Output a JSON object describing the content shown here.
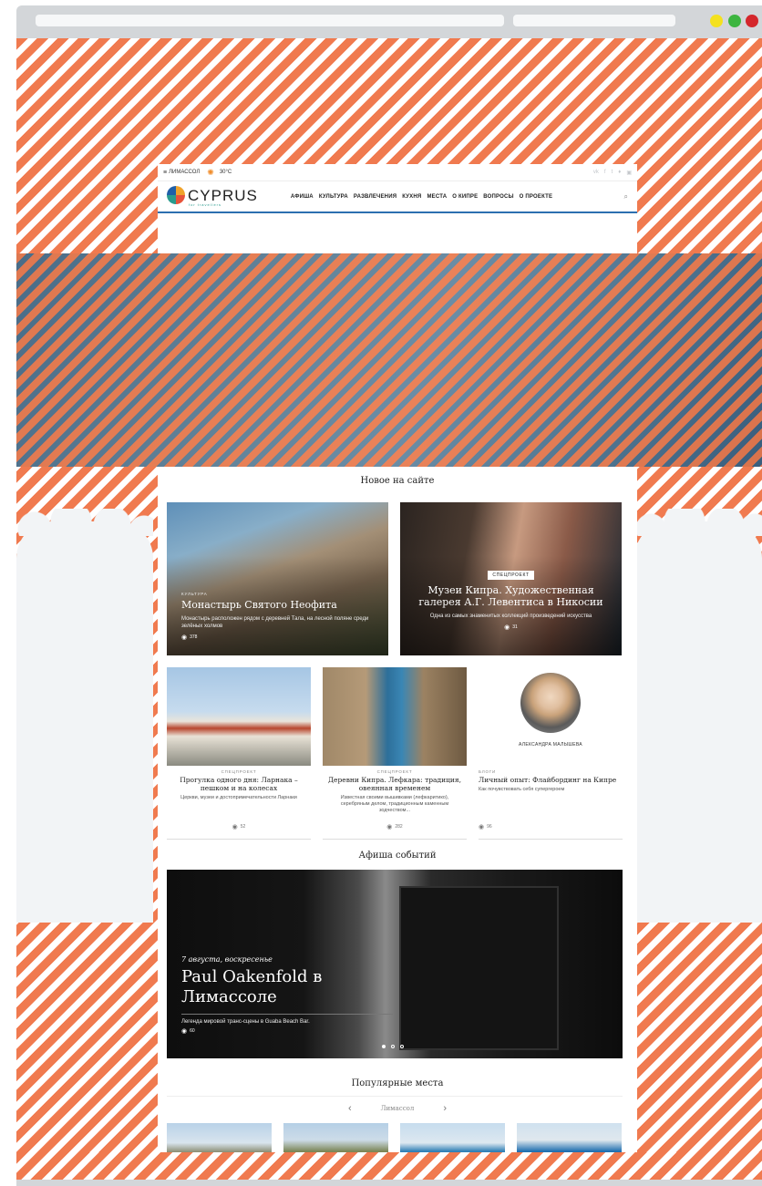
{
  "topbar": {
    "city": "ЛИМАССОЛ",
    "temperature": "30°C",
    "socials": [
      "vk-icon",
      "facebook-icon",
      "tumblr-icon",
      "twitter-icon",
      "instagram-icon"
    ]
  },
  "header": {
    "logo_text": "CYPRUS",
    "logo_sub": "for travellers",
    "nav": [
      "АФИША",
      "КУЛЬТУРА",
      "РАЗВЛЕЧЕНИЯ",
      "КУХНЯ",
      "МЕСТА",
      "О КИПРЕ",
      "ВОПРОСЫ",
      "О ПРОЕКТЕ"
    ]
  },
  "sections": {
    "new": "Новое на сайте",
    "events": "Афиша событий",
    "popular": "Популярные места"
  },
  "featured": [
    {
      "category": "КУЛЬТУРА",
      "title": "Монастырь Святого Неофита",
      "desc": "Монастырь расположен рядом с деревней Тала, на лесной поляне среди зелёных холмов",
      "views": "378"
    },
    {
      "badge": "СПЕЦПРОЕКТ",
      "title": "Музеи Кипра. Художественная галерея А.Г. Левентиса в Никосии",
      "desc": "Одна из самых знаменитых коллекций произведений искусства",
      "views": "31"
    }
  ],
  "cards": [
    {
      "category": "СПЕЦПРОЕКТ",
      "title": "Прогулка одного дня: Ларнака – пешком и на колесах",
      "desc": "Церкви, музеи и достопримечательности Ларнаки",
      "views": "52"
    },
    {
      "category": "СПЕЦПРОЕКТ",
      "title": "Деревни Кипра. Лефкара: традиция, овеянная временем",
      "desc": "Известная своими вышивками (лефкаритико), серебряным делом, традиционным каменным зодчеством...",
      "views": "282"
    },
    {
      "author": "АЛЕКСАНДРА МАЛЫШЕВА",
      "category": "БЛОГИ",
      "title": "Личный опыт: Флайбординг на Кипре",
      "desc": "Как почувствовать себя супергероем",
      "views": "96"
    }
  ],
  "event": {
    "date": "7 августа, воскресенье",
    "title": "Paul Oakenfold в Лимассоле",
    "desc": "Легенда мировой транс-сцены в Guaba Beach Bar.",
    "views": "60"
  },
  "popular": {
    "city": "Лимассол"
  },
  "colors": {
    "stripe": "#f07a4f",
    "accent": "#2c6fb0"
  }
}
